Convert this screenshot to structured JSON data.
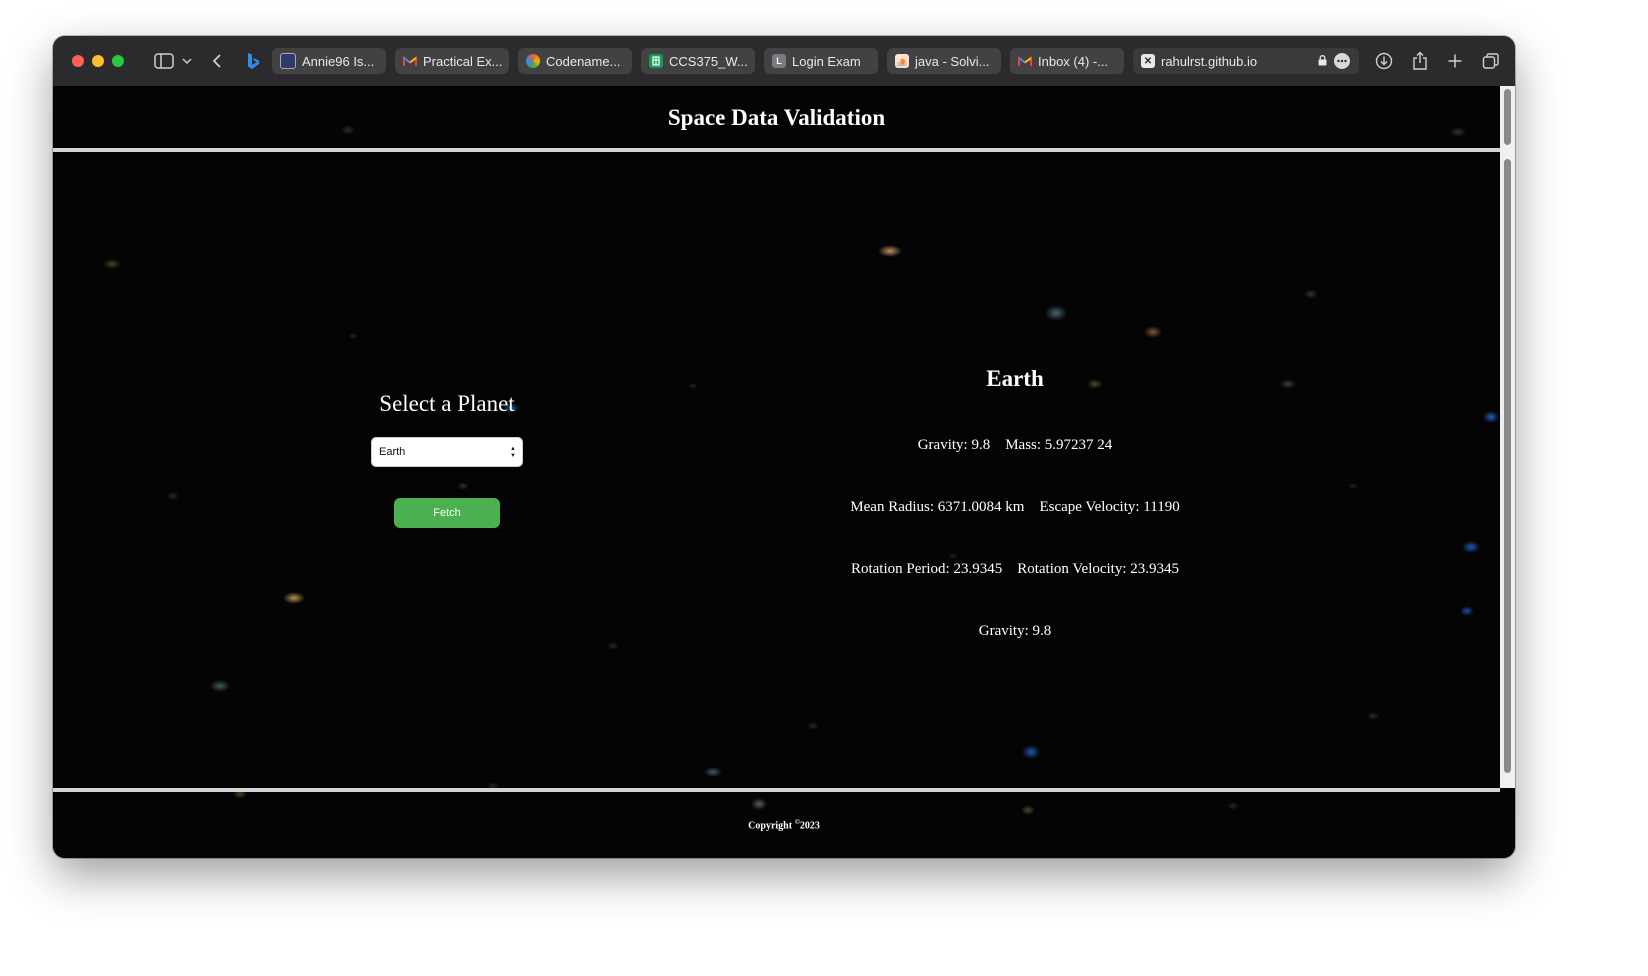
{
  "browser": {
    "tabs": [
      {
        "label": "Annie96 Is...",
        "favicon": "document-favicon",
        "color": "#2f3a6b"
      },
      {
        "label": "Practical Ex...",
        "favicon": "gmail-favicon",
        "color": "#ea4335"
      },
      {
        "label": "Codename...",
        "favicon": "codename-favicon",
        "color": "#e06030"
      },
      {
        "label": "CCS375_W...",
        "favicon": "sheets-favicon",
        "color": "#0f9d58"
      },
      {
        "label": "Login Exam",
        "favicon": "letter-l-favicon",
        "color": "#7a7a7e",
        "letter": "L"
      },
      {
        "label": "java - Solvi...",
        "favicon": "stackoverflow-favicon",
        "color": "#f48024"
      },
      {
        "label": "Inbox (4) -...",
        "favicon": "gmail-favicon",
        "color": "#ea4335"
      }
    ],
    "active_tab": {
      "label": "rahulrst.github.io",
      "favicon": "close-x-favicon"
    }
  },
  "site": {
    "title": "Space Data Validation"
  },
  "selector": {
    "heading": "Select a Planet",
    "selected_planet": "Earth",
    "fetch_label": "Fetch"
  },
  "planet": {
    "name": "Earth",
    "gravity": "Gravity: 9.8",
    "mass": "Mass: 5.97237 24",
    "mean_radius": "Mean Radius: 6371.0084 km",
    "escape_velocity": "Escape Velocity: 11190",
    "rotation_period": "Rotation Period: 23.9345",
    "rotation_velocity": "Rotation Velocity: 23.9345",
    "gravity_repeat": "Gravity: 9.8"
  },
  "footer": {
    "copyright_word": "Copyright ",
    "copyright_symbol": "©",
    "year": "2023"
  },
  "colors": {
    "fetch_button": "#4caf50",
    "background": "#040404",
    "divider": "#d4d4d4"
  }
}
